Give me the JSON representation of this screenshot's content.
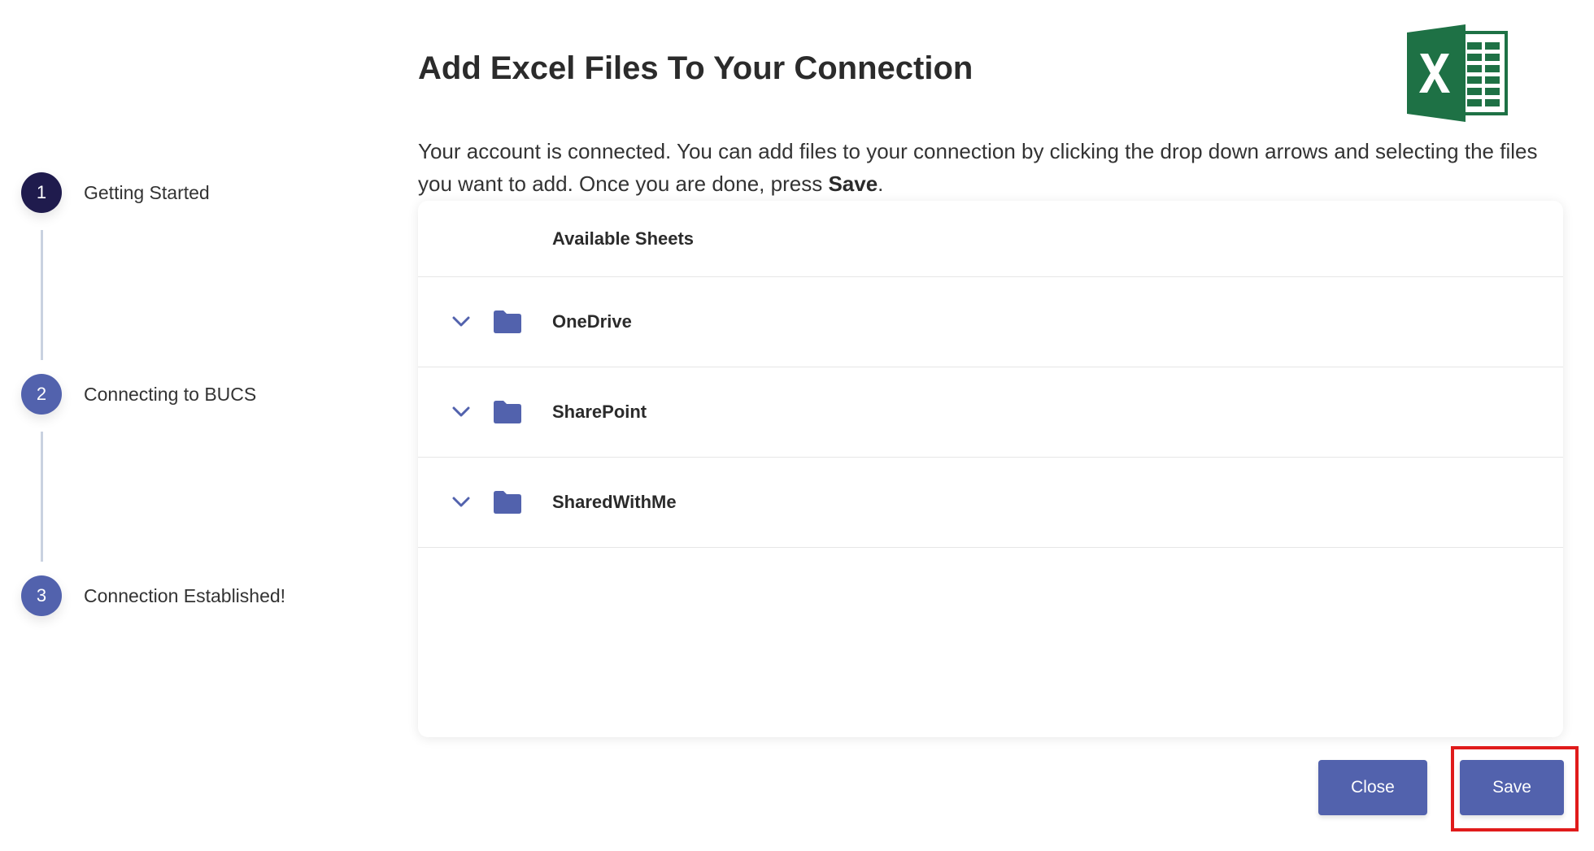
{
  "stepper": {
    "steps": [
      {
        "number": "1",
        "label": "Getting Started",
        "state": "active"
      },
      {
        "number": "2",
        "label": "Connecting to BUCS",
        "state": "pending"
      },
      {
        "number": "3",
        "label": "Connection Established!",
        "state": "pending"
      }
    ]
  },
  "main": {
    "title": "Add Excel Files To Your Connection",
    "intro_text": "Your account is connected. You can add files to your connection by clicking the drop down arrows and selecting the files you want to add. Once you are done, press ",
    "intro_emphasis": "Save",
    "intro_end": ".",
    "logo_icon": "excel-logo-icon"
  },
  "sheets": {
    "header": "Available Sheets",
    "rows": [
      {
        "name": "OneDrive",
        "icon": "folder-icon"
      },
      {
        "name": "SharePoint",
        "icon": "folder-icon"
      },
      {
        "name": "SharedWithMe",
        "icon": "folder-icon"
      }
    ]
  },
  "actions": {
    "close_label": "Close",
    "save_label": "Save"
  },
  "colors": {
    "accent": "#5262ad",
    "active_step": "#1f1b4d",
    "highlight": "#e01b1b",
    "excel_green": "#1e7145"
  }
}
